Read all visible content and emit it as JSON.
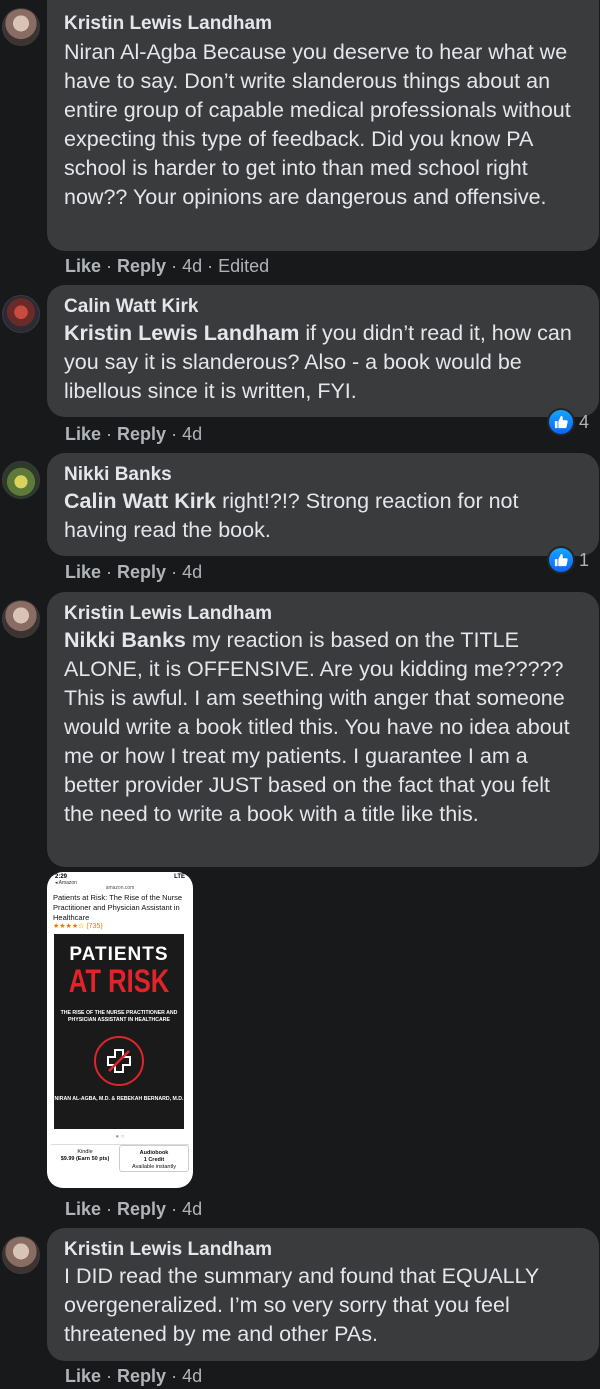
{
  "comments": [
    {
      "author": "Kristin Lewis Landham",
      "mention": "",
      "text": "Niran Al-Agba Because you deserve to hear what we have to say. Don’t write slanderous things about an entire group of capable medical professionals without expecting this type of feedback. Did you know PA school is harder to get into than med school right now?? Your opinions are dangerous and offensive.",
      "like": "Like",
      "reply": "Reply",
      "time": "4d",
      "edited": "Edited"
    },
    {
      "author": "Calin Watt Kirk",
      "mention": "Kristin Lewis Landham",
      "text": " if you didn’t read it, how can you say it is slanderous? Also - a book would be libellous since it is written, FYI.",
      "like": "Like",
      "reply": "Reply",
      "time": "4d",
      "reactions": "4"
    },
    {
      "author": "Nikki Banks",
      "mention": "Calin Watt Kirk",
      "text": " right!?!? Strong reaction for not having read the book.",
      "like": "Like",
      "reply": "Reply",
      "time": "4d",
      "reactions": "1"
    },
    {
      "author": "Kristin Lewis Landham",
      "mention": "Nikki Banks",
      "text": " my reaction is based on the TITLE ALONE, it is OFFENSIVE. Are you kidding me????? This is awful. I am seething with anger that someone would write a book titled this. You have no idea about me or how I treat my patients. I guarantee I am a better provider JUST based on the fact that you felt the need to write a book with a title like this.",
      "like": "Like",
      "reply": "Reply",
      "time": "4d"
    },
    {
      "author": "Kristin Lewis Landham",
      "mention": "",
      "text": "I DID read the summary and found that EQUALLY overgeneralized. I’m so very sorry that you feel threatened by me and other PAs.",
      "like": "Like",
      "reply": "Reply",
      "time": "4d"
    }
  ],
  "attachment": {
    "status_time": "2:29",
    "status_app": "◂ Amazon",
    "status_signal": "LTE",
    "url": "amazon.com",
    "title": "Patients at Risk: The Rise of the Nurse Practitioner and Physician Assistant in Healthcare",
    "stars": "★★★★☆ (735)",
    "cover_line1": "PATIENTS",
    "cover_line2": "AT RISK",
    "cover_subtitle": "THE RISE OF THE NURSE PRACTITIONER AND PHYSICIAN ASSISTANT IN HEALTHCARE",
    "cover_authors": "NIRAN AL-AGBA, M.D. & REBEKAH BERNARD, M.D.",
    "dots": "● ○",
    "kindle_label": "Kindle",
    "kindle_price": "$9.99 (Earn 50 pts)",
    "audio_label": "Audiobook",
    "audio_price": "1 Credit",
    "audio_note": "Available instantly"
  }
}
